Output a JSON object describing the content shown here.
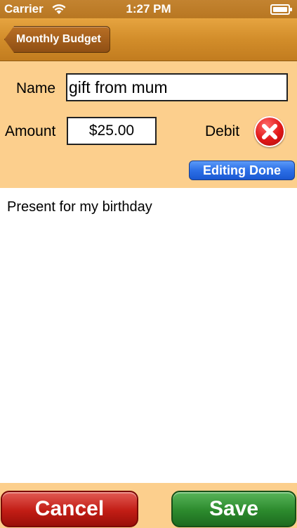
{
  "status_bar": {
    "carrier": "Carrier",
    "time": "1:27 PM"
  },
  "nav": {
    "back_label": "Monthly Budget"
  },
  "form": {
    "name_label": "Name",
    "name_value": "gift from mum",
    "amount_label": "Amount",
    "amount_value": "$25.00",
    "type_label": "Debit",
    "editing_done_label": "Editing Done"
  },
  "notes": {
    "text": "Present for my birthday"
  },
  "actions": {
    "cancel_label": "Cancel",
    "save_label": "Save"
  },
  "colors": {
    "nav_bar": "#d28d2a",
    "form_background": "#fccf8d",
    "debit_icon": "#e11818",
    "editing_done": "#2c6fe6",
    "cancel": "#c21d15",
    "save": "#2c8a2d"
  },
  "icons": {
    "wifi": "wifi-icon",
    "battery": "battery-icon",
    "debit": "close-icon"
  }
}
